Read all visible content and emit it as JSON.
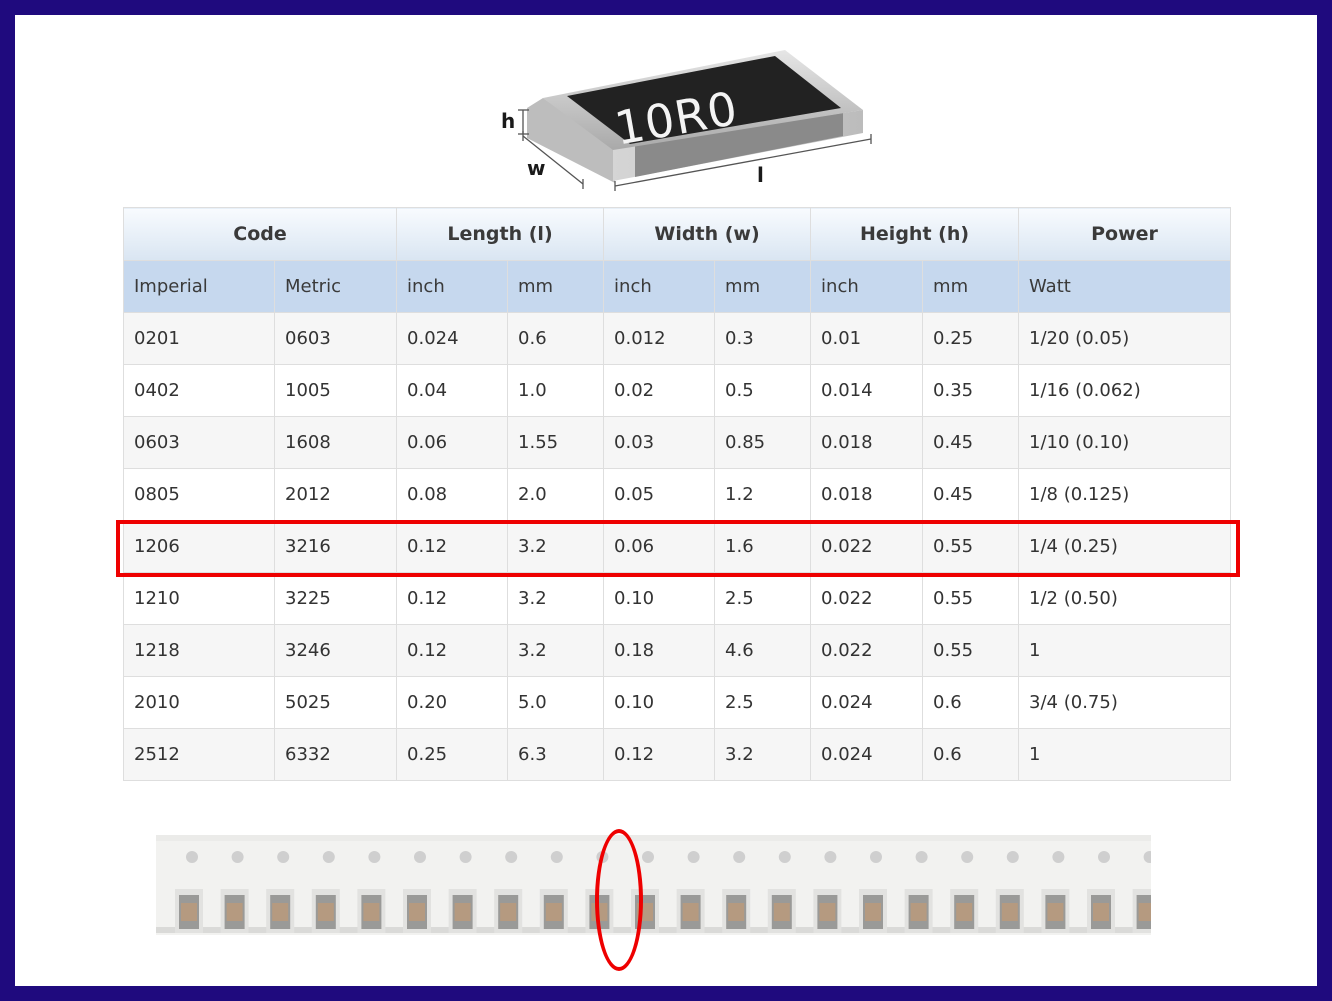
{
  "figure": {
    "marking": "10R0",
    "dimension_labels": {
      "height": "h",
      "width": "w",
      "length": "l"
    },
    "body_color": "#222222",
    "terminal_color": "#c8c8c8"
  },
  "table": {
    "group_headers": [
      "Code",
      "Length (l)",
      "Width (w)",
      "Height (h)",
      "Power"
    ],
    "sub_headers": [
      "Imperial",
      "Metric",
      "inch",
      "mm",
      "inch",
      "mm",
      "inch",
      "mm",
      "Watt"
    ],
    "rows": [
      [
        "0201",
        "0603",
        "0.024",
        "0.6",
        "0.012",
        "0.3",
        "0.01",
        "0.25",
        "1/20 (0.05)"
      ],
      [
        "0402",
        "1005",
        "0.04",
        "1.0",
        "0.02",
        "0.5",
        "0.014",
        "0.35",
        "1/16 (0.062)"
      ],
      [
        "0603",
        "1608",
        "0.06",
        "1.55",
        "0.03",
        "0.85",
        "0.018",
        "0.45",
        "1/10 (0.10)"
      ],
      [
        "0805",
        "2012",
        "0.08",
        "2.0",
        "0.05",
        "1.2",
        "0.018",
        "0.45",
        "1/8 (0.125)"
      ],
      [
        "1206",
        "3216",
        "0.12",
        "3.2",
        "0.06",
        "1.6",
        "0.022",
        "0.55",
        "1/4 (0.25)"
      ],
      [
        "1210",
        "3225",
        "0.12",
        "3.2",
        "0.10",
        "2.5",
        "0.022",
        "0.55",
        "1/2 (0.50)"
      ],
      [
        "1218",
        "3246",
        "0.12",
        "3.2",
        "0.18",
        "4.6",
        "0.022",
        "0.55",
        "1"
      ],
      [
        "2010",
        "5025",
        "0.20",
        "5.0",
        "0.10",
        "2.5",
        "0.024",
        "0.6",
        "3/4 (0.75)"
      ],
      [
        "2512",
        "6332",
        "0.25",
        "6.3",
        "0.12",
        "3.2",
        "0.024",
        "0.6",
        "1"
      ]
    ],
    "highlighted_row": 4,
    "highlight_color": "#ee0000",
    "header_color": "#c6d8ee"
  },
  "tape": {
    "component_count": 22,
    "highlighted_component": 10,
    "component_color": "#b59a80",
    "highlight_color": "#ee0000"
  }
}
